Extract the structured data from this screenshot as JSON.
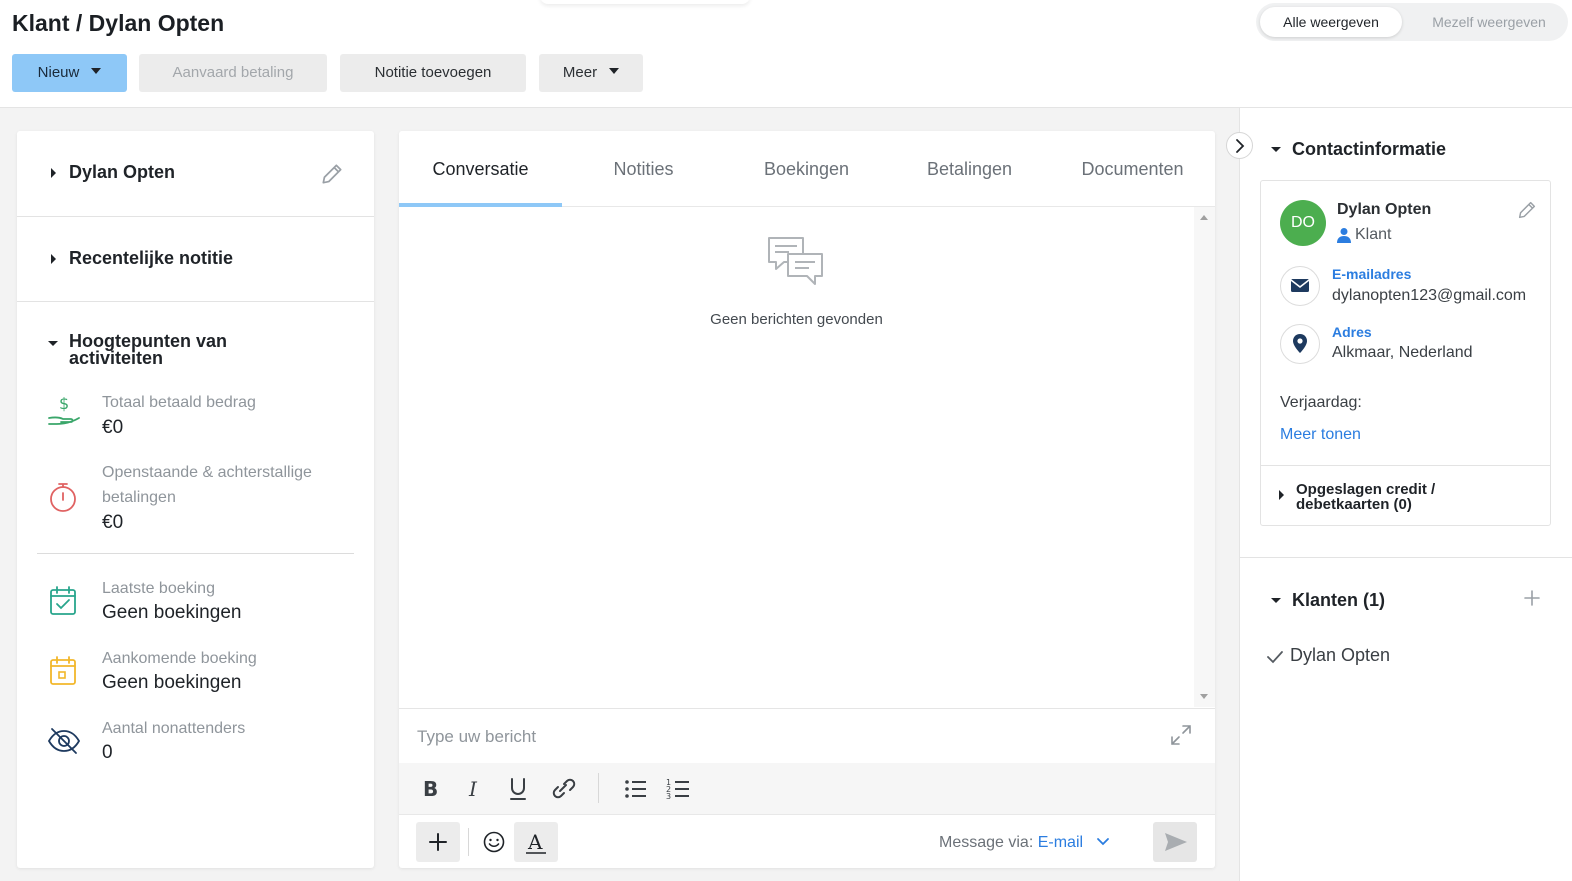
{
  "header": {
    "title": "Klant / Dylan Opten",
    "view_toggle": {
      "all": "Alle weergeven",
      "self": "Mezelf weergeven"
    },
    "buttons": {
      "new": "Nieuw",
      "accept_payment": "Aanvaard betaling",
      "add_note": "Notitie toevoegen",
      "more": "Meer"
    }
  },
  "left": {
    "customer_name": "Dylan Opten",
    "recent_note_title": "Recentelijke notitie",
    "highlights_title": "Hoogtepunten van activiteiten",
    "stats": [
      {
        "label": "Totaal betaald bedrag",
        "value": "€0"
      },
      {
        "label": "Openstaande & achterstallige betalingen",
        "value": "€0"
      },
      {
        "label": "Laatste boeking",
        "value": "Geen boekingen"
      },
      {
        "label": "Aankomende boeking",
        "value": "Geen boekingen"
      },
      {
        "label": "Aantal nonattenders",
        "value": "0"
      }
    ]
  },
  "center": {
    "tabs": [
      "Conversatie",
      "Notities",
      "Boekingen",
      "Betalingen",
      "Documenten"
    ],
    "active_tab": "Conversatie",
    "empty_message": "Geen berichten gevonden",
    "compose": {
      "placeholder": "Type uw bericht",
      "message_via_label": "Message via:",
      "message_via_value": "E-mail"
    }
  },
  "right": {
    "contact_title": "Contactinformatie",
    "avatar_initials": "DO",
    "avatar_color": "#4cae4f",
    "name": "Dylan Opten",
    "role": "Klant",
    "email_label": "E-mailadres",
    "email_value": "dylanopten123@gmail.com",
    "address_label": "Adres",
    "address_value": "Alkmaar, Nederland",
    "birthday_label": "Verjaardag:",
    "show_more": "Meer tonen",
    "saved_cards": "Opgeslagen credit / debetkaarten (0)",
    "customers_title": "Klanten (1)",
    "customers": [
      "Dylan Opten"
    ]
  },
  "colors": {
    "accent": "#8ec8f7",
    "link": "#2b7de0",
    "tab_underline": "#8ec8f7"
  }
}
